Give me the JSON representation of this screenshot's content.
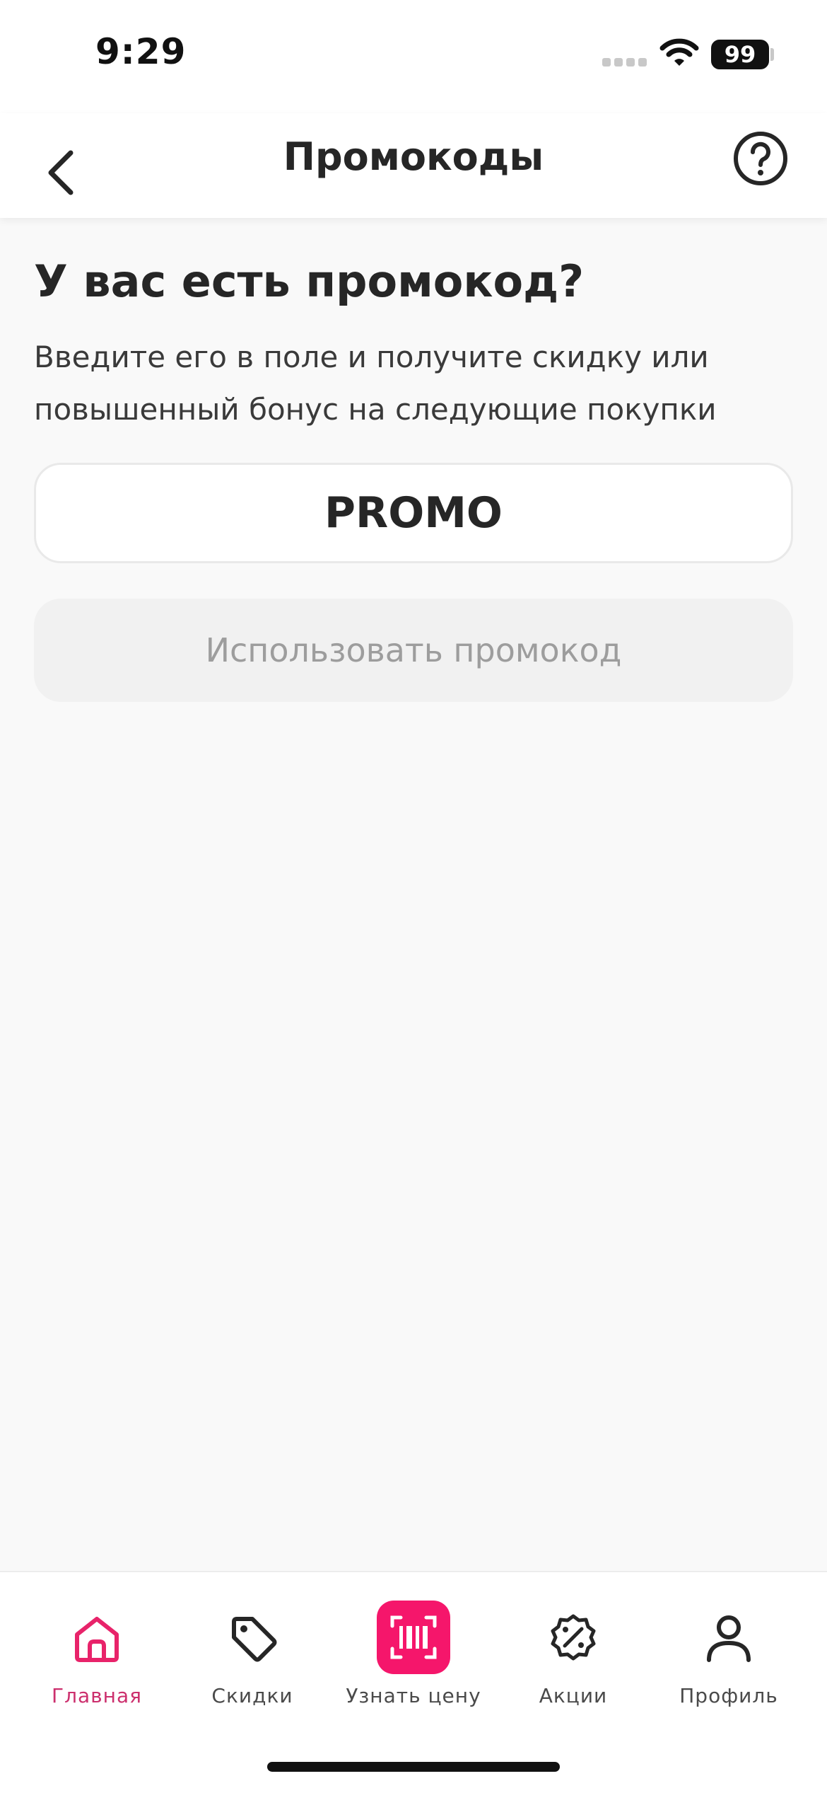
{
  "status_bar": {
    "time": "9:29",
    "battery": "99"
  },
  "header": {
    "title": "Промокоды"
  },
  "main": {
    "heading": "У вас есть промокод?",
    "subtitle_line1": "Введите его в поле и получите скидку или",
    "subtitle_line2": "повышенный бонус на следующие покупки",
    "promo_input_value": "PROMO",
    "apply_button_label": "Использовать промокод"
  },
  "tab_bar": {
    "items": [
      {
        "label": "Главная",
        "icon": "home-icon",
        "active": true
      },
      {
        "label": "Скидки",
        "icon": "tag-icon",
        "active": false
      },
      {
        "label": "Узнать цену",
        "icon": "barcode-scan-icon",
        "active": false
      },
      {
        "label": "Акции",
        "icon": "percent-badge-icon",
        "active": false
      },
      {
        "label": "Профиль",
        "icon": "user-icon",
        "active": false
      }
    ]
  },
  "colors": {
    "accent": "#f5166b",
    "active_tab_label": "#cc2f6d",
    "background": "#f9f9f9",
    "disabled_button_bg": "#f1f1f1",
    "disabled_button_text": "#9d9d9d"
  }
}
